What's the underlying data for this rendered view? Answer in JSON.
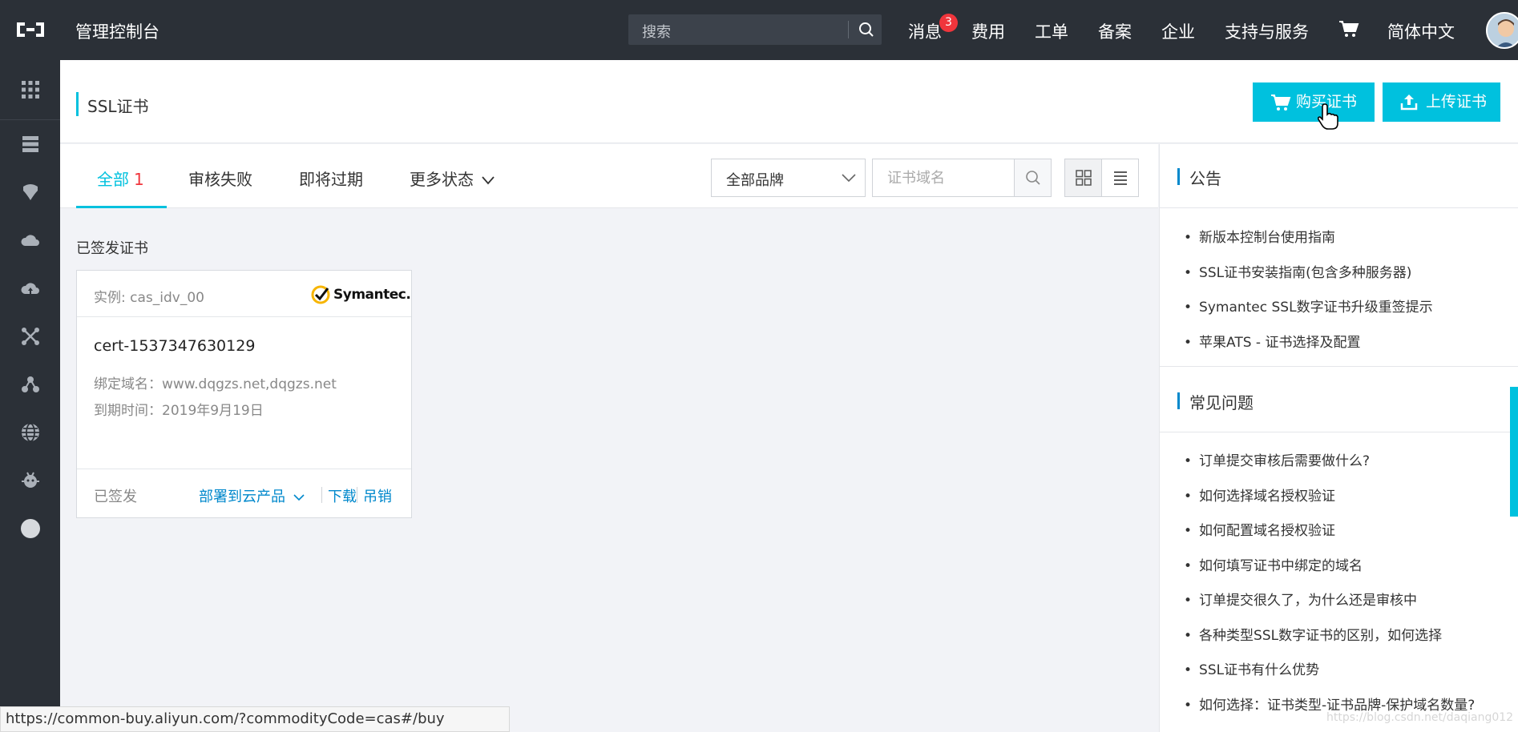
{
  "topbar": {
    "title": "管理控制台",
    "search_placeholder": "搜索",
    "nav": {
      "messages": "消息",
      "messages_badge": "3",
      "billing": "费用",
      "tickets": "工单",
      "icp": "备案",
      "enterprise": "企业",
      "support": "支持与服务",
      "language": "简体中文"
    }
  },
  "page": {
    "title": "SSL证书",
    "buy_button": "购买证书",
    "upload_button": "上传证书"
  },
  "tabs": [
    {
      "label": "全部",
      "count": "1"
    },
    {
      "label": "审核失败"
    },
    {
      "label": "即将过期"
    },
    {
      "label": "更多状态"
    }
  ],
  "filters": {
    "brand_select": "全部品牌",
    "domain_placeholder": "证书域名"
  },
  "section_label": "已签发证书",
  "card": {
    "instance": "实例: cas_idv_00",
    "brand": "Symantec.",
    "name": "cert-1537347630129",
    "domain": "绑定域名：www.dqgzs.net,dqgzs.net",
    "expiry": "到期时间：2019年9月19日",
    "status": "已签发",
    "actions": {
      "deploy": "部署到云产品",
      "download": "下载",
      "revoke": "吊销"
    }
  },
  "announcements": {
    "title": "公告",
    "items": [
      "新版本控制台使用指南",
      "SSL证书安装指南(包含多种服务器)",
      "Symantec SSL数字证书升级重签提示",
      "苹果ATS - 证书选择及配置"
    ]
  },
  "faq": {
    "title": "常见问题",
    "items": [
      "订单提交审核后需要做什么?",
      "如何选择域名授权验证",
      "如何配置域名授权验证",
      "如何填写证书中绑定的域名",
      "订单提交很久了，为什么还是审核中",
      "各种类型SSL数字证书的区别，如何选择",
      "SSL证书有什么优势",
      "如何选择：证书类型-证书品牌-保护域名数量?"
    ]
  },
  "statusbar": "https://common-buy.aliyun.com/?commodityCode=cas#/buy",
  "watermark": "https://blog.csdn.net/daqiang012",
  "colors": {
    "accent": "#00c1de",
    "topbar": "#2b3037",
    "link": "#0088cc",
    "badge": "#f0353c"
  },
  "icons": [
    "logo-icon",
    "search-icon",
    "cart-icon",
    "grid-menu-icon",
    "server-icon",
    "database-icon",
    "cloud-icon",
    "upload-cloud-icon",
    "network-icon",
    "cluster-icon",
    "globe-icon",
    "bug-icon",
    "circle-icon",
    "chevron-down-icon",
    "grid-view-icon",
    "list-view-icon",
    "upload-icon"
  ]
}
